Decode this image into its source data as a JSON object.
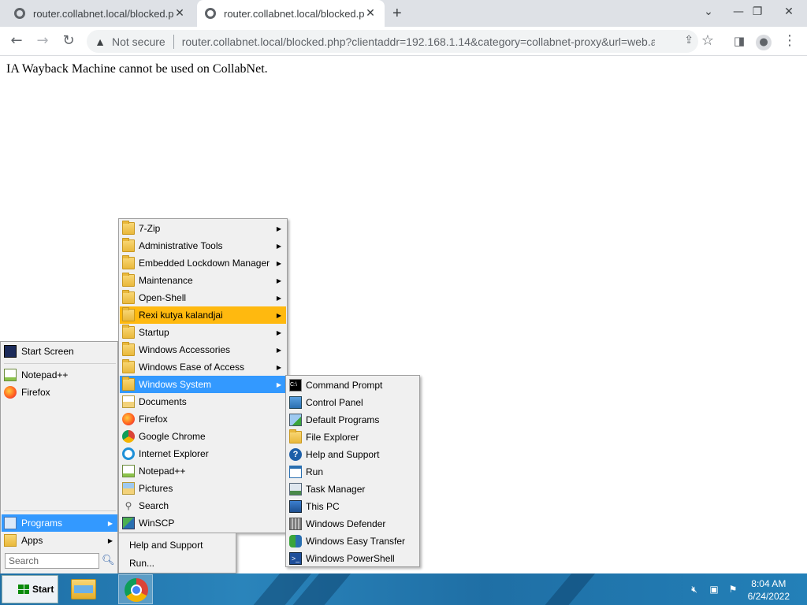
{
  "browser": {
    "tabs": [
      {
        "title": "router.collabnet.local/blocked.php",
        "active": false
      },
      {
        "title": "router.collabnet.local/blocked.php",
        "active": true
      }
    ],
    "not_secure_label": "Not secure",
    "url": "router.collabnet.local/blocked.php?clientaddr=192.168.1.14&category=collabnet-proxy&url=web.a..."
  },
  "page": {
    "message": "IA Wayback Machine cannot be used on CollabNet."
  },
  "start_menu": {
    "items": [
      {
        "label": "Start Screen",
        "icon": "start-screen-icon"
      },
      {
        "label": "Notepad++",
        "icon": "notepad-plus-plus-icon"
      },
      {
        "label": "Firefox",
        "icon": "firefox-icon"
      },
      {
        "label": "Programs",
        "icon": "programs-icon"
      },
      {
        "label": "Apps",
        "icon": "apps-icon"
      }
    ],
    "search_placeholder": "Search"
  },
  "programs_menu": {
    "items": [
      {
        "label": "7-Zip",
        "submenu": true
      },
      {
        "label": "Administrative Tools",
        "submenu": true
      },
      {
        "label": "Embedded Lockdown Manager",
        "submenu": true
      },
      {
        "label": "Maintenance",
        "submenu": true
      },
      {
        "label": "Open-Shell",
        "submenu": true
      },
      {
        "label": "Rexi kutya kalandjai",
        "submenu": true
      },
      {
        "label": "Startup",
        "submenu": true
      },
      {
        "label": "Windows Accessories",
        "submenu": true
      },
      {
        "label": "Windows Ease of Access",
        "submenu": true
      },
      {
        "label": "Windows System",
        "submenu": true
      },
      {
        "label": "Documents"
      },
      {
        "label": "Firefox"
      },
      {
        "label": "Google Chrome"
      },
      {
        "label": "Internet Explorer"
      },
      {
        "label": "Notepad++"
      },
      {
        "label": "Pictures"
      },
      {
        "label": "Search"
      },
      {
        "label": "WinSCP"
      }
    ]
  },
  "extra_panel": {
    "help_label": "Help and Support",
    "run_label": "Run..."
  },
  "system_menu": {
    "items": [
      {
        "label": "Command Prompt"
      },
      {
        "label": "Control Panel"
      },
      {
        "label": "Default Programs"
      },
      {
        "label": "File Explorer"
      },
      {
        "label": "Help and Support"
      },
      {
        "label": "Run"
      },
      {
        "label": "Task Manager"
      },
      {
        "label": "This PC"
      },
      {
        "label": "Windows Defender"
      },
      {
        "label": "Windows Easy Transfer"
      },
      {
        "label": "Windows PowerShell"
      }
    ]
  },
  "taskbar": {
    "start_label": "Start",
    "time": "8:04 AM",
    "date": "6/24/2022"
  },
  "colors": {
    "highlight_blue": "#3399ff",
    "hot_orange": "#ffb90f",
    "taskbar": "#2a84bb"
  }
}
